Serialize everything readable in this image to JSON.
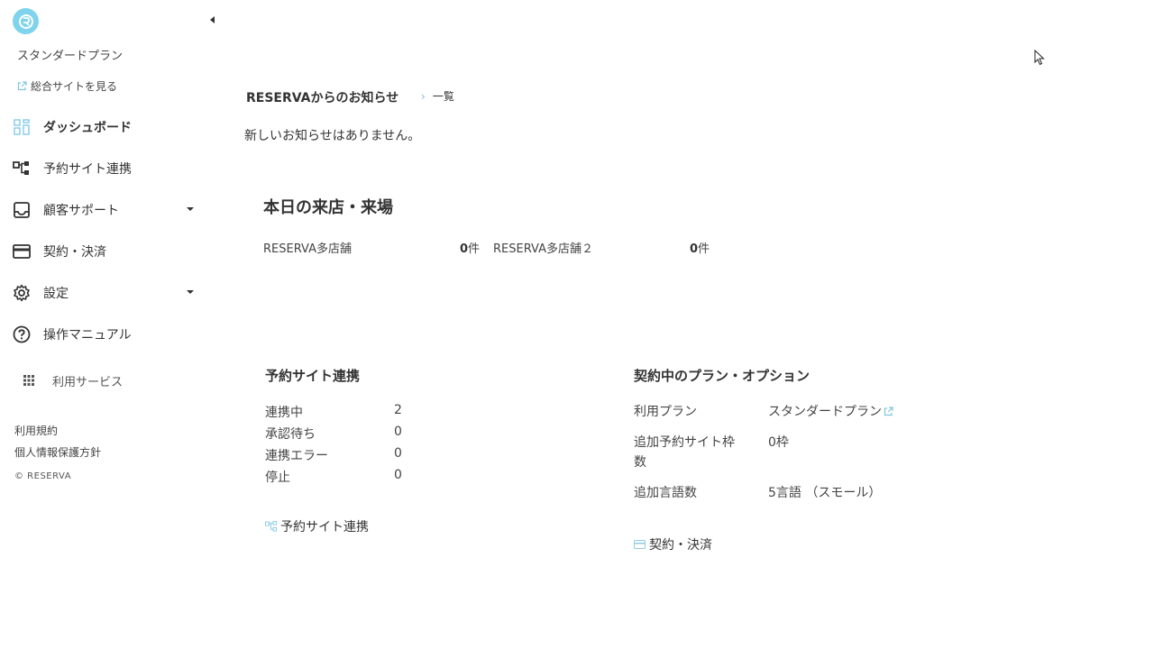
{
  "sidebar": {
    "plan_name": "スタンダードプラン",
    "site_link": "総合サイトを見る",
    "nav": [
      {
        "label": "ダッシュボード",
        "icon": "dashboard-icon",
        "active": true
      },
      {
        "label": "予約サイト連携",
        "icon": "sitemap-icon"
      },
      {
        "label": "顧客サポート",
        "icon": "inbox-icon",
        "has_submenu": true
      },
      {
        "label": "契約・決済",
        "icon": "credit-card-icon"
      },
      {
        "label": "設定",
        "icon": "gear-icon",
        "has_submenu": true
      },
      {
        "label": "操作マニュアル",
        "icon": "help-circle-icon"
      }
    ],
    "services_label": "利用サービス",
    "footer": {
      "terms": "利用規約",
      "privacy": "個人情報保護方針",
      "copyright": "© RESERVA"
    }
  },
  "news": {
    "title": "RESERVAからのお知らせ",
    "more_label": "一覧",
    "empty_text": "新しいお知らせはありません。"
  },
  "visits": {
    "title": "本日の来店・来場",
    "stores": [
      {
        "name": "RESERVA多店舗",
        "count": "0",
        "unit": "件"
      },
      {
        "name": "RESERVA多店舗２",
        "count": "0",
        "unit": "件"
      }
    ]
  },
  "site_link_section": {
    "title": "予約サイト連携",
    "rows": [
      {
        "label": "連携中",
        "value": "2"
      },
      {
        "label": "承認待ち",
        "value": "0"
      },
      {
        "label": "連携エラー",
        "value": "0"
      },
      {
        "label": "停止",
        "value": "0"
      }
    ],
    "action_label": "予約サイト連携"
  },
  "plan_section": {
    "title": "契約中のプラン・オプション",
    "plan_label": "利用プラン",
    "plan_value": "スタンダードプラン",
    "extra_site_label_1": "追加予約サイト枠",
    "extra_site_label_2": "数",
    "extra_site_value": "0枠",
    "extra_lang_label": "追加言語数",
    "extra_lang_value": "5言語 （スモール）",
    "action_label": "契約・決済"
  },
  "colors": {
    "accent": "#7fd3ec",
    "icon_light": "#8ccde6",
    "text": "#333333"
  }
}
